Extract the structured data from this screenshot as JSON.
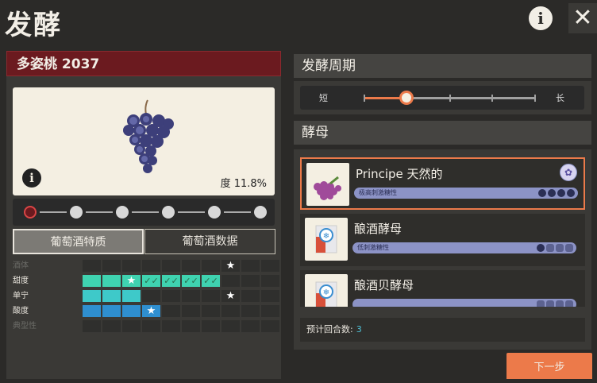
{
  "header": {
    "title": "发酵",
    "info_icon": "i",
    "close_icon": "✕"
  },
  "wine": {
    "name": "多姿桃 2037",
    "degree_label": "度 11.8%",
    "info_icon": "i",
    "track_positions": 6,
    "track_active_index": 0
  },
  "tabs": {
    "selected": "葡萄酒特质",
    "other": "葡萄酒数据"
  },
  "attributes": [
    {
      "label": "酒体",
      "dim": true,
      "filled": 0,
      "color": "#3fd3b0",
      "star_at": 7,
      "checks": 0
    },
    {
      "label": "甜度",
      "dim": false,
      "filled": 7,
      "color": "#3fd3b0",
      "star_at": 2,
      "checks": 5
    },
    {
      "label": "单宁",
      "dim": false,
      "filled": 3,
      "color": "#3ec9c9",
      "star_at": 7,
      "checks": 0
    },
    {
      "label": "酸度",
      "dim": false,
      "filled": 4,
      "color": "#2f8fd0",
      "star_at": 3,
      "checks": 0
    },
    {
      "label": "典型性",
      "dim": true,
      "filled": 0,
      "color": "#3fd3b0",
      "star_at": -1,
      "checks": 0
    }
  ],
  "fermentation": {
    "title": "发酵周期",
    "short_label": "短",
    "long_label": "长",
    "level": 0.25,
    "tick_count": 5
  },
  "yeast": {
    "title": "酵母",
    "items": [
      {
        "name": "Principe 天然的",
        "tag": "极高刺激糖性",
        "selected": true,
        "pips_filled": 4,
        "badge": "✿",
        "icon": "grape-cluster-icon"
      },
      {
        "name": "酿酒酵母",
        "tag": "低刺激糖性",
        "selected": false,
        "pips_filled": 1,
        "badge": "",
        "icon": "yeast-flask-icon"
      },
      {
        "name": "酿酒贝酵母",
        "tag": "",
        "selected": false,
        "pips_filled": 0,
        "badge": "",
        "icon": "yeast-flask-icon"
      }
    ],
    "estimate_label": "预计回合数:",
    "estimate_value": "3"
  },
  "next_button": "下一步",
  "colors": {
    "accent": "#ec7a4a",
    "wine_header": "#6b1a1f",
    "panel": "#3a3936",
    "yeast_bar": "#8c93c6"
  }
}
